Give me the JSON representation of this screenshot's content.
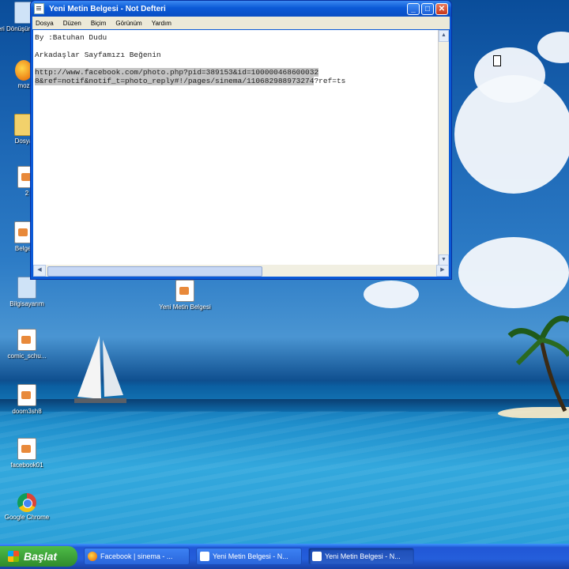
{
  "window": {
    "title": "Yeni Metin Belgesi - Not Defteri",
    "menu": [
      "Dosya",
      "Düzen",
      "Biçim",
      "Görünüm",
      "Yardım"
    ],
    "content": {
      "line1": "By :Batuhan Dudu",
      "line2": "Arkadaşlar Sayfamızı Beğenin",
      "url_line1": "http://www.facebook.com/photo.php?pid=389153&id=100000468600032",
      "url_line2_selected": "8&ref=notif&notif_t=photo_reply#!/pages/sinema/110682988973274",
      "url_line2_rest": "?ref=ts"
    }
  },
  "desktop_icons": [
    {
      "label": "Geri Dönüşüm Kutusu",
      "icon": "recycle-bin-icon"
    },
    {
      "label": "moz",
      "icon": "firefox-icon"
    },
    {
      "label": "Dosya",
      "icon": "folder-icon"
    },
    {
      "label": "2",
      "icon": "document-icon"
    },
    {
      "label": "Belgel",
      "icon": "document-icon"
    },
    {
      "label": "Bilgisayarım",
      "icon": "my-computer-icon"
    },
    {
      "label": "comic_schu...",
      "icon": "document-icon"
    },
    {
      "label": "doom3sh8",
      "icon": "document-icon"
    },
    {
      "label": "facebook01",
      "icon": "document-icon"
    },
    {
      "label": "Google Chrome",
      "icon": "chrome-icon"
    },
    {
      "label": "Yeni Metin Belgesi",
      "icon": "text-file-icon"
    }
  ],
  "taskbar": {
    "start_label": "Başlat",
    "tasks": [
      {
        "label": "Facebook | sinema - ...",
        "icon": "firefox-icon"
      },
      {
        "label": "Yeni Metin Belgesi - N...",
        "icon": "notepad-icon"
      },
      {
        "label": "Yeni Metin Belgesi - N...",
        "icon": "notepad-icon"
      }
    ]
  }
}
